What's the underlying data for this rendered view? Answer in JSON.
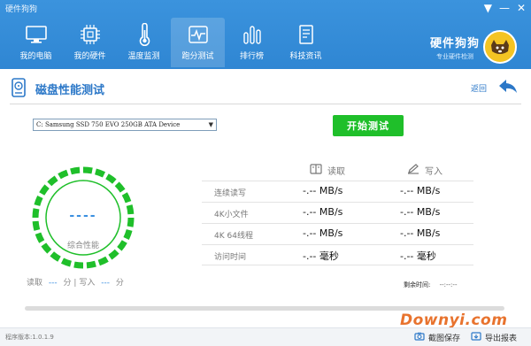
{
  "window": {
    "title": "硬件狗狗",
    "controls": [
      "▼",
      "—",
      "✕"
    ]
  },
  "nav": [
    {
      "label": "我的电脑",
      "icon": "monitor-icon"
    },
    {
      "label": "我的硬件",
      "icon": "chip-icon"
    },
    {
      "label": "温度监测",
      "icon": "thermometer-icon"
    },
    {
      "label": "跑分测试",
      "icon": "pulse-icon",
      "active": true
    },
    {
      "label": "排行榜",
      "icon": "bars-icon"
    },
    {
      "label": "科技资讯",
      "icon": "document-icon"
    }
  ],
  "brand": {
    "name": "硬件狗狗",
    "tagline": "专业硬件检测",
    "logo": "dog-logo-icon"
  },
  "page": {
    "title": "磁盘性能测试",
    "back_label": "返回"
  },
  "device": {
    "selected": "C: Samsung SSD 750 EVO 250GB ATA Device"
  },
  "start_button": "开始测试",
  "gauge": {
    "score": "----",
    "label": "综合性能",
    "color": "#1fbf2a"
  },
  "gauge_stats": {
    "read_label": "读取",
    "read_value": "---",
    "unit1": "分",
    "sep": "|",
    "write_label": "写入",
    "write_value": "---",
    "unit2": "分"
  },
  "results": {
    "read_header": "读取",
    "write_header": "写入",
    "rows": [
      {
        "label": "连续读写",
        "read": "-.-- MB/s",
        "write": "-.-- MB/s"
      },
      {
        "label": "4K小文件",
        "read": "-.-- MB/s",
        "write": "-.-- MB/s"
      },
      {
        "label": "4K 64线程",
        "read": "-.-- MB/s",
        "write": "-.-- MB/s"
      },
      {
        "label": "访问时间",
        "read": "-.-- 毫秒",
        "write": "-.-- 毫秒"
      }
    ]
  },
  "remaining": {
    "label": "剩余时间:",
    "value": "--:--:--"
  },
  "progress": 0,
  "footer": {
    "version": "程序版本:1.0.1.9",
    "screenshot": "截图保存",
    "export": "导出报表"
  },
  "watermark": "Downyi.com",
  "colors": {
    "header": "#3189d6",
    "accent": "#2c78c8",
    "green": "#1fbf2a",
    "score": "#3a8fe0"
  }
}
